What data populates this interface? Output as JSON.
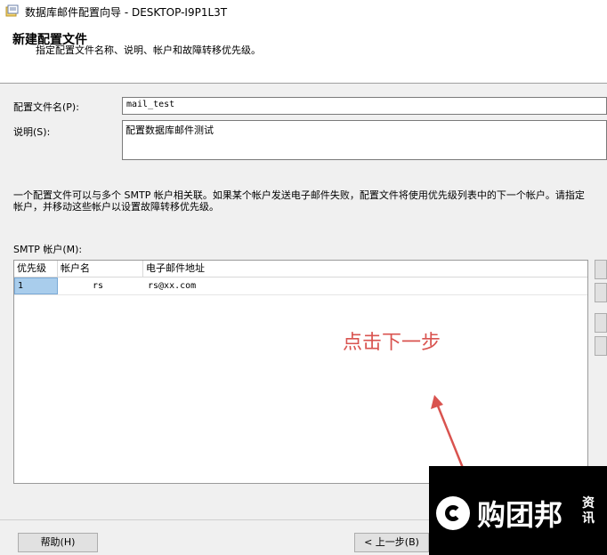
{
  "window": {
    "title": "数据库邮件配置向导 - DESKTOP-I9P1L3T"
  },
  "header": {
    "title": "新建配置文件",
    "subtitle": "指定配置文件名称、说明、帐户和故障转移优先级。"
  },
  "form": {
    "profile_name_label": "配置文件名(P):",
    "profile_name_value": "mail_test",
    "description_label": "说明(S):",
    "description_value": "配置数据库邮件测试"
  },
  "info_text": {
    "line1": "一个配置文件可以与多个 SMTP 帐户相关联。如果某个帐户发送电子邮件失败，配置文件将使用优先级列表中的下一个帐户。请指定",
    "line2": "帐户，并移动这些帐户以设置故障转移优先级。"
  },
  "smtp_accounts": {
    "label": "SMTP 帐户(M):",
    "columns": [
      "优先级",
      "帐户名",
      "电子邮件地址"
    ],
    "rows": [
      {
        "priority": "1",
        "account": "rs",
        "email": "rs@xx.com"
      }
    ]
  },
  "annotation": {
    "text": "点击下一步",
    "color": "#d9534f"
  },
  "footer": {
    "help_label": "帮助(H)",
    "back_label": "< 上一步(B)"
  },
  "watermark": {
    "brand": "购团邦",
    "side_text": "资讯"
  },
  "icons": {
    "app": "wizard-icon"
  }
}
